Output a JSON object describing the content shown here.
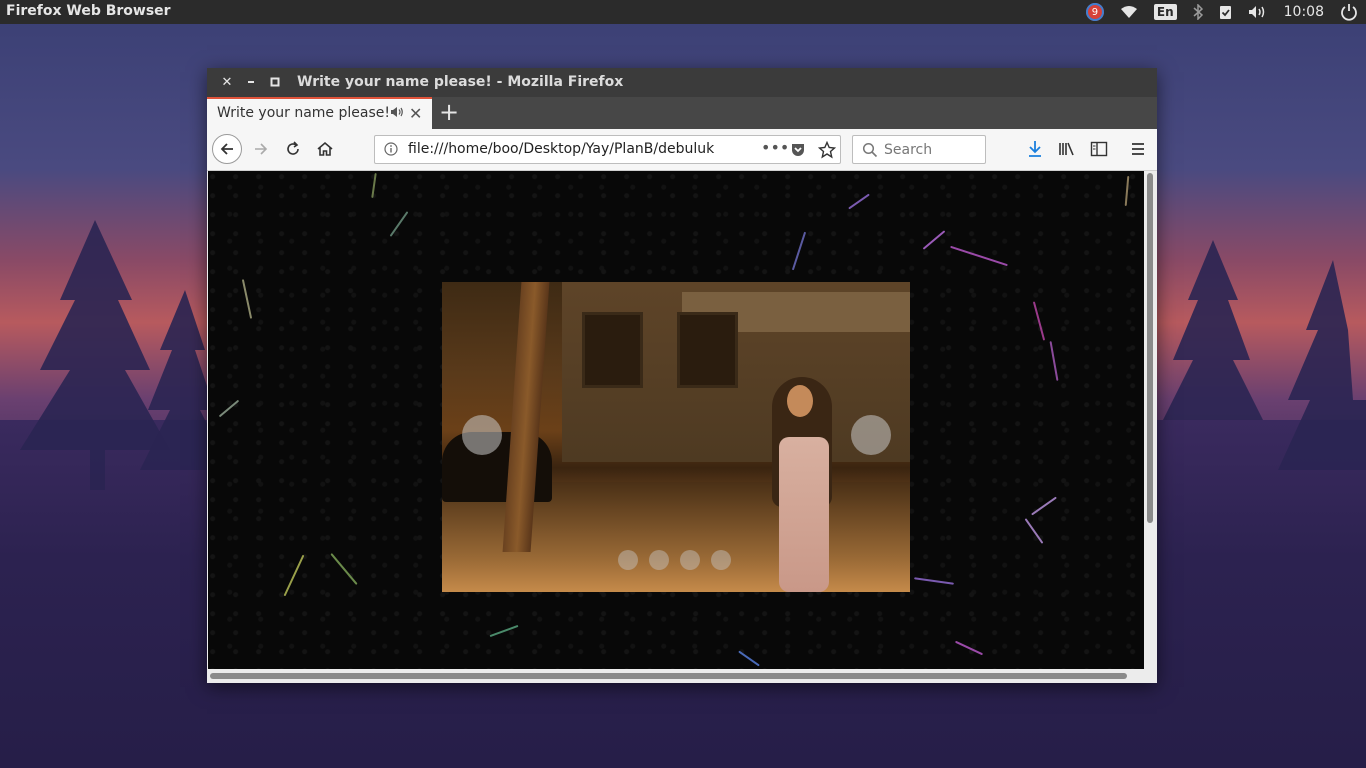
{
  "top_panel": {
    "app_name": "Firefox Web Browser",
    "notification_count": "9",
    "keyboard_layout": "En",
    "clock": "10:08"
  },
  "window": {
    "title": "Write your name please! - Mozilla Firefox",
    "tab": {
      "label": "Write your name please!"
    },
    "url": "file:///home/boo/Desktop/Yay/PlanB/debuluk",
    "search_placeholder": "Search"
  },
  "slider": {
    "dot_count": 4
  },
  "colors": {
    "tab_accent": "#e0533a",
    "panel": "#2b2b2b",
    "download_icon": "#1a7fdd"
  }
}
